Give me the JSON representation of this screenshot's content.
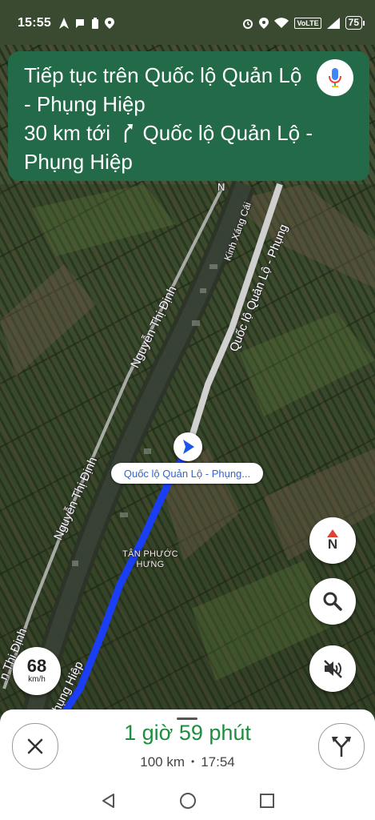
{
  "status_bar": {
    "time": "15:55",
    "left_icons": [
      "navigation-arrow-icon",
      "chat-icon",
      "battery-saver-icon",
      "location-pin-icon"
    ],
    "right_icons": [
      "alarm-icon",
      "location-pin-icon",
      "wifi-icon",
      "volte-badge",
      "signal-icon"
    ],
    "volte": "VoLTE",
    "battery": "75"
  },
  "navigation": {
    "instruction": "Tiếp tục trên Quốc lộ Quản Lộ - Phụng Hiệp",
    "distance_text": "30 km tới",
    "next_road": "Quốc lộ Quản Lộ - Phụng Hiệp",
    "mic_icon": "microphone-icon"
  },
  "map": {
    "current_road": "Quốc lộ Quản Lộ - Phụng...",
    "labels": {
      "nguyen_thi_dinh_1": "Nguyễn Thị Định",
      "nguyen_thi_dinh_2": "Nguyễn Thị Định",
      "nguyen_thi_dinh_3": "n Thị Định",
      "ql_upper": "Quốc lộ Quản Lộ - Phụng",
      "ql_lower": "hụng Hiệp",
      "canal": "Kinh Xáng Cái",
      "partial_n": "N",
      "place_line1": "TÂN PHƯỚC",
      "place_line2": "HƯNG"
    },
    "colors": {
      "route": "#1a3ef5",
      "road": "#c9c9c9",
      "banner": "#226a48",
      "eta": "#1e8e3e"
    }
  },
  "controls": {
    "compass_label": "N",
    "search_icon": "search-icon",
    "mute_icon": "sound-off-icon",
    "speed": "68",
    "speed_unit": "km/h"
  },
  "trip": {
    "duration": "1 giờ 59 phút",
    "distance": "100 km",
    "separator": "•",
    "arrival": "17:54"
  },
  "system_nav": [
    "back-icon",
    "home-icon",
    "recents-icon"
  ]
}
